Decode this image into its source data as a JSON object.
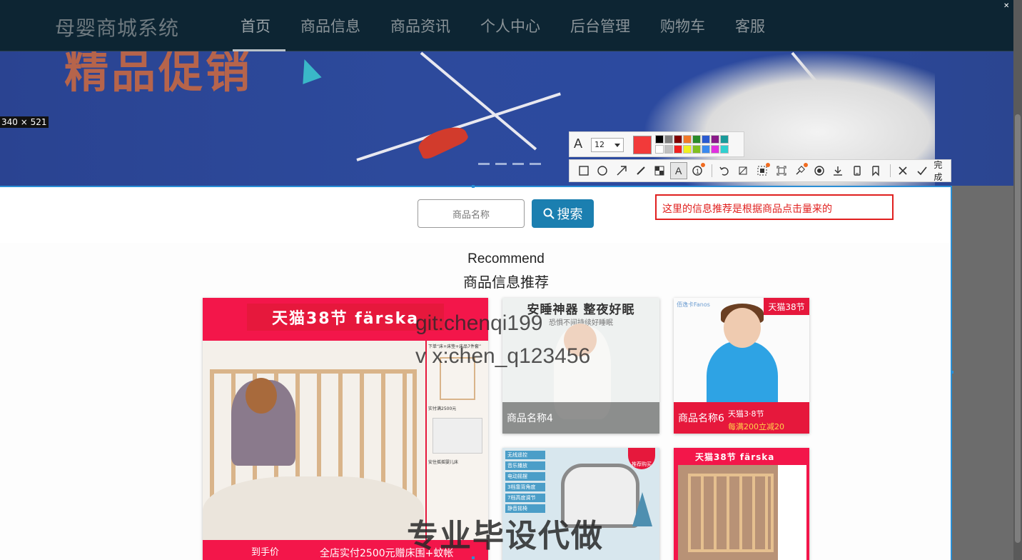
{
  "nav": {
    "brand": "母婴商城系统",
    "items": [
      "首页",
      "商品信息",
      "商品资讯",
      "个人中心",
      "后台管理",
      "购物车",
      "客服"
    ]
  },
  "banner": {
    "title": "精品促销"
  },
  "dimension_label": "340 × 521",
  "search": {
    "placeholder": "商品名称",
    "button_label": "搜索"
  },
  "annotation_text": "这里的信息推荐是根据商品点击量来的",
  "recommend": {
    "title_en": "Recommend",
    "title_cn": "商品信息推荐",
    "cards": [
      {
        "label": "",
        "top_text": "天猫38节 färska",
        "bottom_text": "到手价",
        "bottom_text2": "全店实付2500元赠床围+蚊帐",
        "side_texts": [
          "下单“床+床垫+床品7件套”",
          "实付满2500元",
          "安住摇摇婴儿床"
        ]
      },
      {
        "label": "商品名称4",
        "title": "安睡神器 整夜好眠",
        "subtitle": "恐惧不间持续好睡眠"
      },
      {
        "label": "商品名称6",
        "tag": "天猫38节",
        "logo": "佰逸卡Fanos",
        "band_text": "天猫3·8节",
        "band_text2": "每满200立减20"
      },
      {
        "label": "",
        "list": [
          "无线遥控",
          "音乐播放",
          "电动摇摆",
          "3档靠背角度",
          "7档高度调节",
          "静音摇椅"
        ],
        "badge": "推荐购买"
      },
      {
        "label": "",
        "top_text": "天猫38节 färska"
      }
    ]
  },
  "watermarks": {
    "line1": "git:chenqi199",
    "line2": "v x:chen_q123456",
    "line3": "专业毕设代做"
  },
  "toolbar": {
    "font_size": "12",
    "current_color": "#f23a3a",
    "palette": [
      "#000000",
      "#808080",
      "#800000",
      "#f07828",
      "#2a8a2a",
      "#2a5ad0",
      "#8a1a8a",
      "#1a9a9a",
      "#ffffff",
      "#c0c0c0",
      "#f02020",
      "#f0f020",
      "#80c020",
      "#3a8af0",
      "#e030e0",
      "#30d0d0"
    ],
    "done_label": "完成",
    "tools": [
      "rectangle-tool",
      "ellipse-tool",
      "arrow-tool",
      "pen-tool",
      "mosaic-tool",
      "text-tool",
      "number-tool",
      "undo-tool",
      "pin-tool",
      "ocr-tool",
      "scroll-capture-tool",
      "pin-to-screen-tool",
      "record-tool",
      "save-tool",
      "copy-tool",
      "bookmark-tool",
      "cancel-tool",
      "done-tool"
    ]
  }
}
